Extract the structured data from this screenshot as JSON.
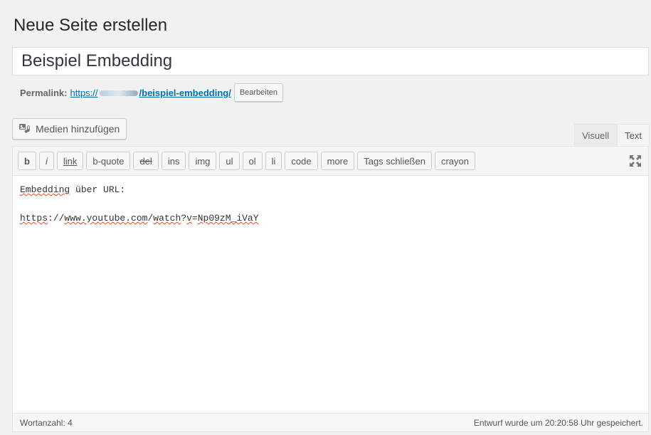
{
  "page": {
    "heading": "Neue Seite erstellen"
  },
  "title_field": {
    "value": "Beispiel Embedding"
  },
  "permalink": {
    "label": "Permalink:",
    "prefix": "https://",
    "slug": "/beispiel-embedding/",
    "edit_button": "Bearbeiten"
  },
  "media": {
    "button_label": "Medien hinzufügen",
    "icon": "media-icon"
  },
  "tabs": {
    "visual": "Visuell",
    "text": "Text"
  },
  "quicktags": [
    {
      "label": "b",
      "name": "qt-bold-button",
      "style": "b"
    },
    {
      "label": "i",
      "name": "qt-italic-button",
      "style": "i"
    },
    {
      "label": "link",
      "name": "qt-link-button",
      "style": "link"
    },
    {
      "label": "b-quote",
      "name": "qt-blockquote-button",
      "style": ""
    },
    {
      "label": "del",
      "name": "qt-del-button",
      "style": "del"
    },
    {
      "label": "ins",
      "name": "qt-ins-button",
      "style": ""
    },
    {
      "label": "img",
      "name": "qt-img-button",
      "style": ""
    },
    {
      "label": "ul",
      "name": "qt-ul-button",
      "style": ""
    },
    {
      "label": "ol",
      "name": "qt-ol-button",
      "style": ""
    },
    {
      "label": "li",
      "name": "qt-li-button",
      "style": ""
    },
    {
      "label": "code",
      "name": "qt-code-button",
      "style": ""
    },
    {
      "label": "more",
      "name": "qt-more-button",
      "style": ""
    },
    {
      "label": "Tags schließen",
      "name": "qt-close-tags-button",
      "style": ""
    },
    {
      "label": "crayon",
      "name": "qt-crayon-button",
      "style": ""
    }
  ],
  "editor": {
    "line1_word": "Embedding",
    "line1_rest": " über URL:",
    "url_part1": "https",
    "url_part2": "://",
    "url_part3": "www.youtube.com",
    "url_part4": "/",
    "url_part5": "watch",
    "url_part6": "?",
    "url_part7": "v",
    "url_part8": "=",
    "url_part9": "Np09zM_iVaY"
  },
  "status": {
    "word_count": "Wortanzahl: 4",
    "saved": "Entwurf wurde um 20:20:58 Uhr gespeichert."
  },
  "colors": {
    "link": "#0073aa",
    "background": "#f1f1f1",
    "spellcheck": "#d54e21"
  }
}
